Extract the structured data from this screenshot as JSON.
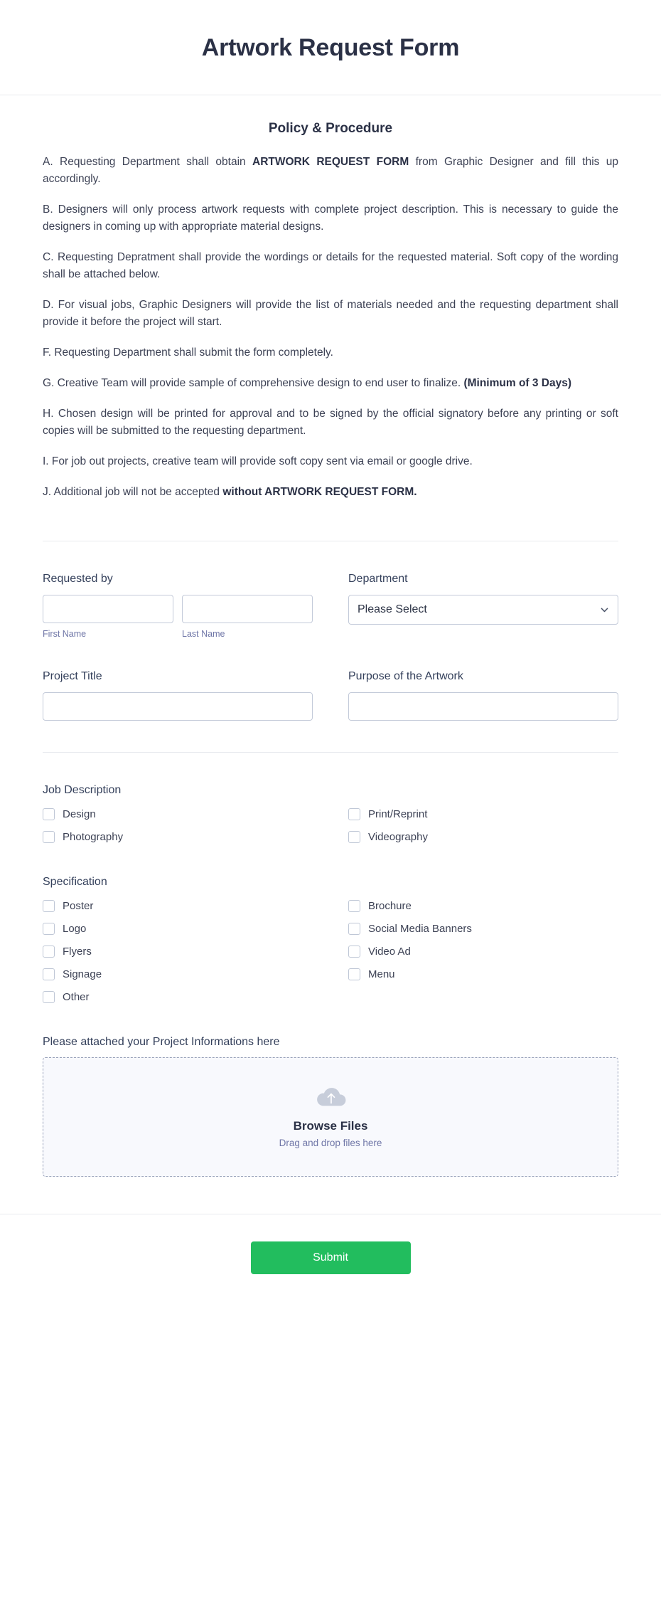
{
  "header": {
    "title": "Artwork Request Form"
  },
  "policy": {
    "heading": "Policy & Procedure",
    "items": [
      {
        "pre": "A. Requesting Department shall obtain ",
        "bold": "ARTWORK REQUEST FORM",
        "post": " from Graphic Designer and fill this up accordingly."
      },
      {
        "pre": "B. Designers will only process artwork requests with complete project description. This is necessary to guide the designers in coming up with appropriate material designs.",
        "bold": "",
        "post": ""
      },
      {
        "pre": "C. Requesting Depratment shall provide the wordings or details for the requested material. Soft copy of the wording shall be attached below.",
        "bold": "",
        "post": ""
      },
      {
        "pre": "D. For visual jobs, Graphic Designers will provide the list of materials needed and the requesting department shall provide it before the project will start.",
        "bold": "",
        "post": ""
      },
      {
        "pre": "F. Requesting Department shall submit the form completely.",
        "bold": "",
        "post": ""
      },
      {
        "pre": "G. Creative Team will provide sample of comprehensive design to end user to finalize. ",
        "bold": "(Minimum of 3 Days)",
        "post": ""
      },
      {
        "pre": "H. Chosen design will be printed for approval and to be signed by the official signatory before any printing or soft copies will be submitted to the requesting department.",
        "bold": "",
        "post": ""
      },
      {
        "pre": "I. For job out projects, creative team will provide soft copy sent via email or google drive.",
        "bold": "",
        "post": ""
      },
      {
        "pre": "J. Additional job will not be accepted ",
        "bold": "without ARTWORK REQUEST FORM.",
        "post": ""
      }
    ]
  },
  "fields": {
    "requested_by": {
      "label": "Requested by",
      "first_name": {
        "value": "",
        "placeholder": "",
        "sub_label": "First Name"
      },
      "last_name": {
        "value": "",
        "placeholder": "",
        "sub_label": "Last Name"
      }
    },
    "department": {
      "label": "Department",
      "selected": "Please Select",
      "chevron_icon": "chevron-down-icon"
    },
    "project_title": {
      "label": "Project Title",
      "value": "",
      "placeholder": ""
    },
    "purpose": {
      "label": "Purpose of the Artwork",
      "value": "",
      "placeholder": ""
    }
  },
  "job_description": {
    "title": "Job Description",
    "left": [
      "Design",
      "Photography"
    ],
    "right": [
      "Print/Reprint",
      "Videography"
    ]
  },
  "specification": {
    "title": "Specification",
    "left": [
      "Poster",
      "Logo",
      "Flyers",
      "Signage",
      "Other"
    ],
    "right": [
      "Brochure",
      "Social Media Banners",
      "Video Ad",
      "Menu"
    ]
  },
  "upload": {
    "label": "Please attached your Project Informations here",
    "icon": "cloud-upload-icon",
    "browse_label": "Browse Files",
    "drag_text": "Drag and drop files here"
  },
  "footer": {
    "submit_label": "Submit",
    "submit_color": "#22bd5e"
  }
}
